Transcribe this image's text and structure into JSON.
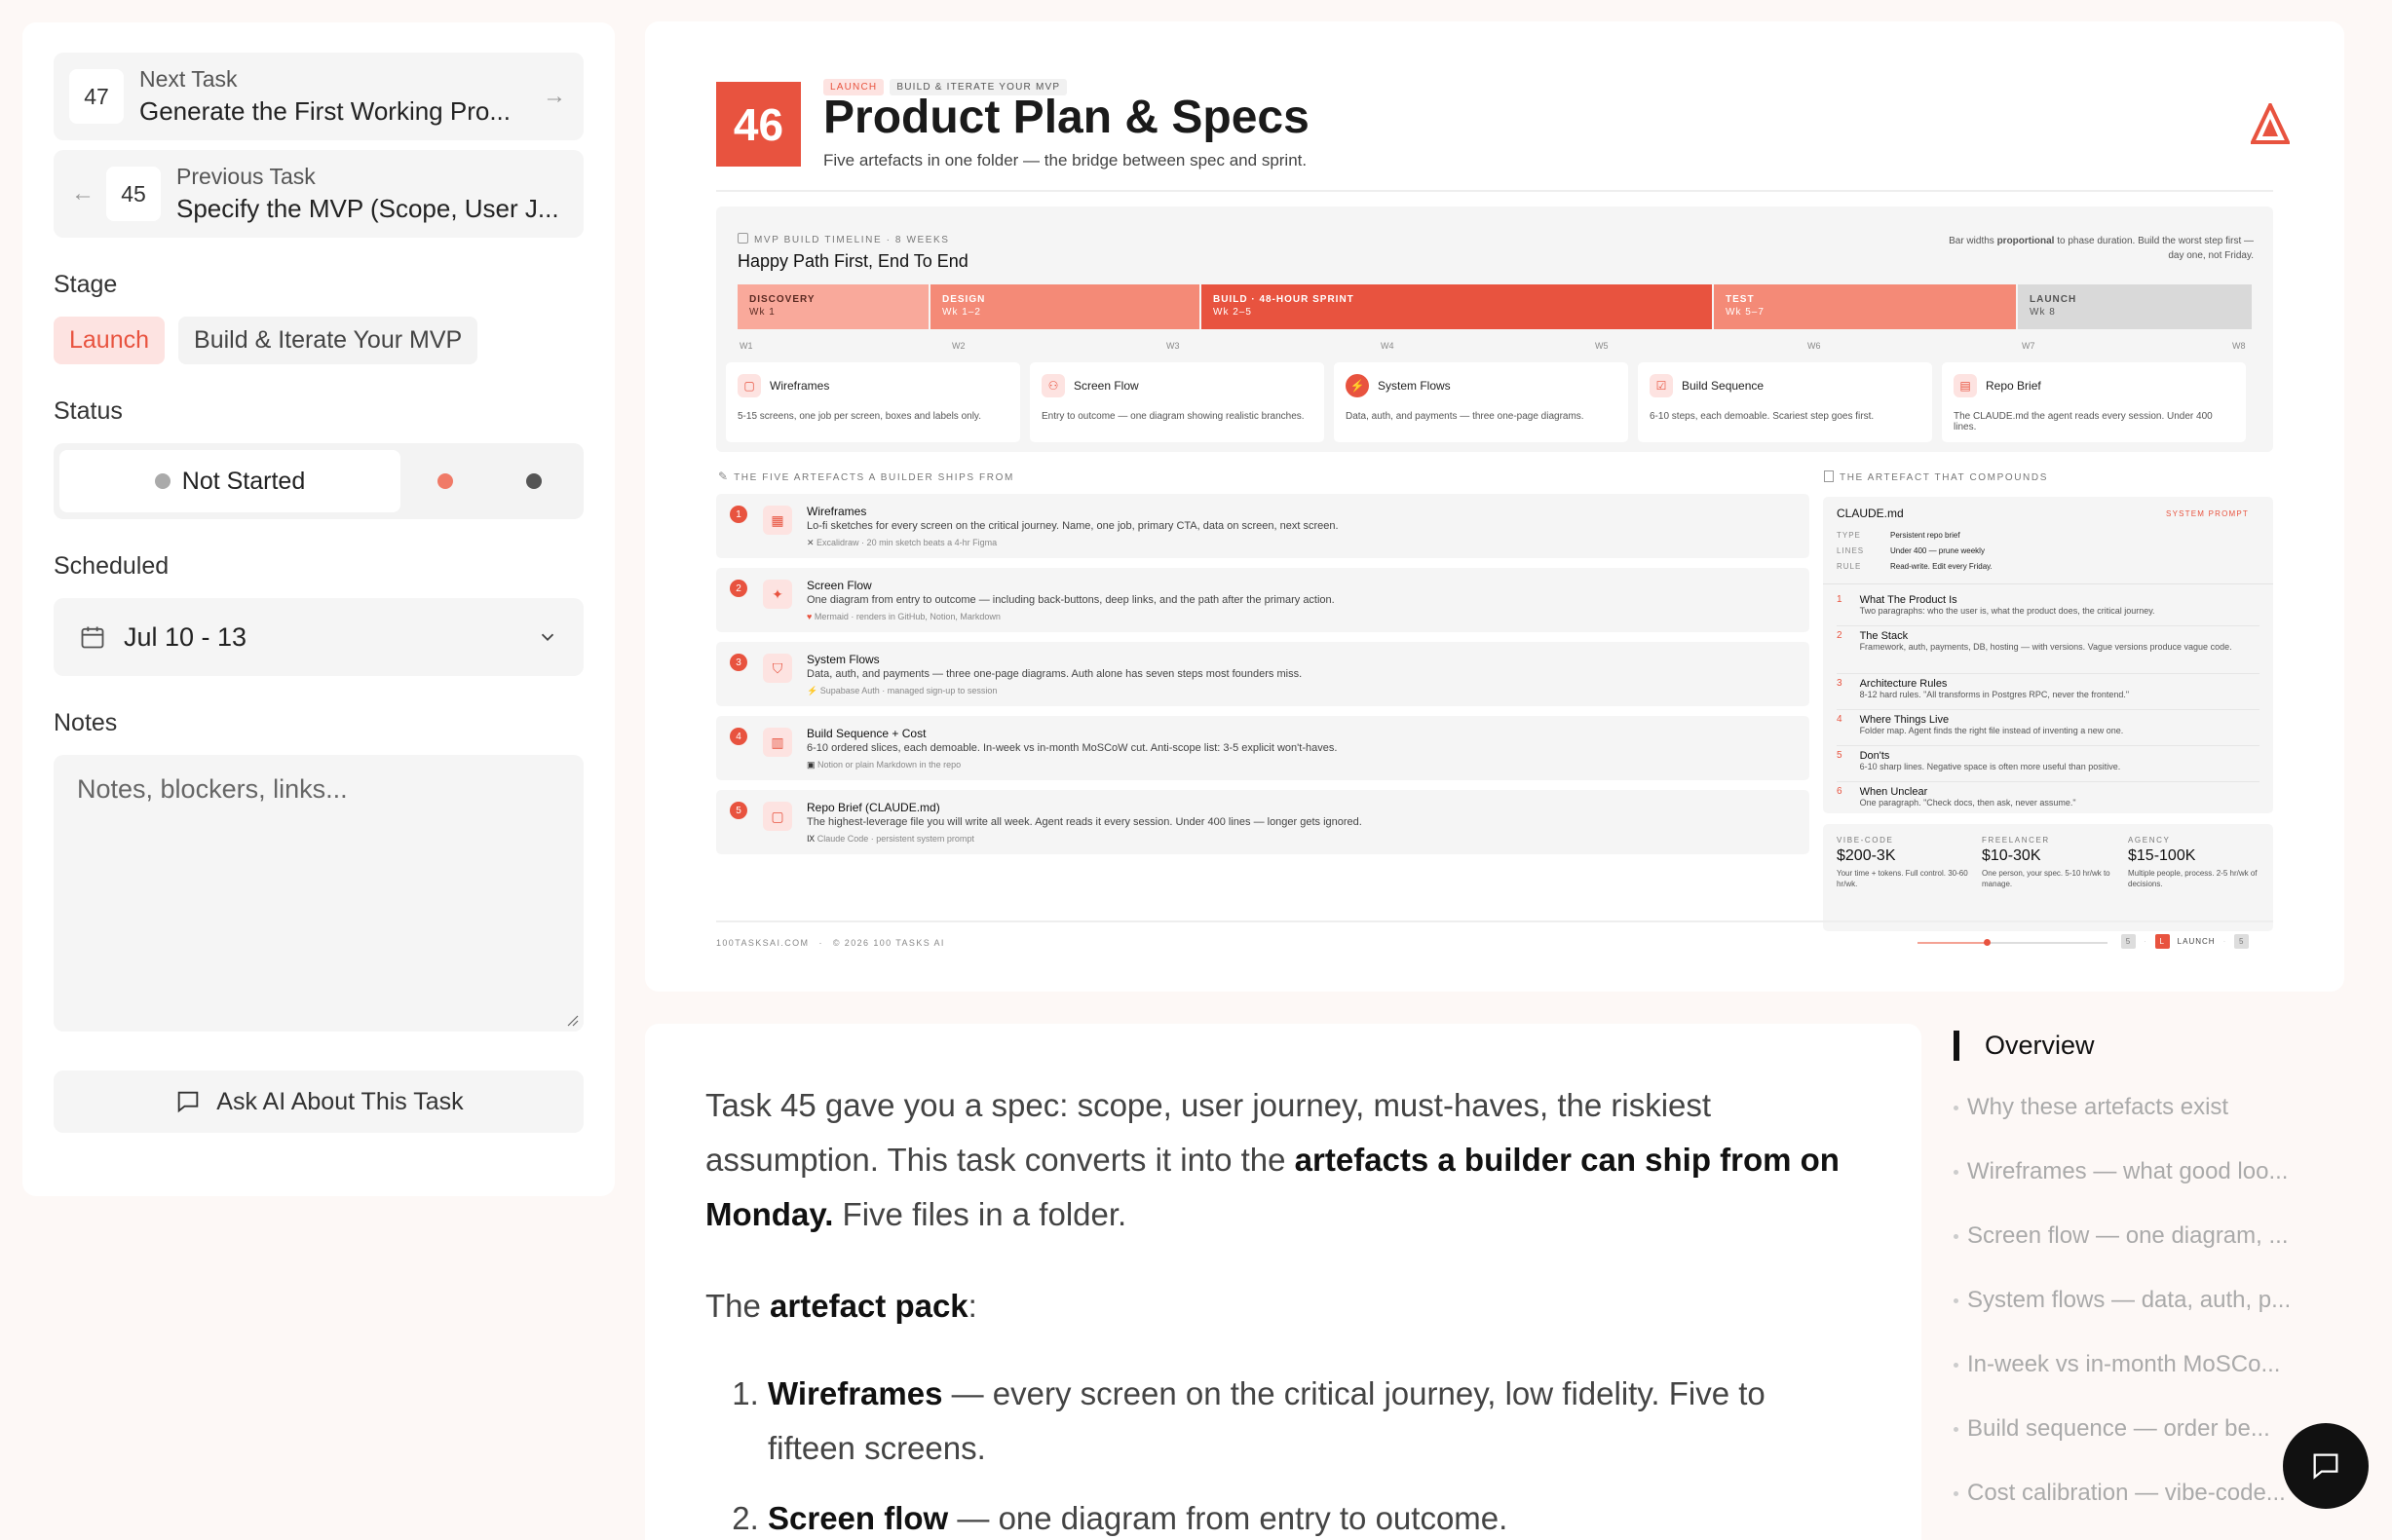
{
  "sidebar": {
    "next": {
      "num": "47",
      "kicker": "Next Task",
      "title": "Generate the First Working Pro..."
    },
    "prev": {
      "num": "45",
      "kicker": "Previous Task",
      "title": "Specify the MVP (Scope, User J..."
    },
    "stage_label": "Stage",
    "stage_chips": [
      "Launch",
      "Build & Iterate Your MVP"
    ],
    "status_label": "Status",
    "status_value": "Not Started",
    "scheduled_label": "Scheduled",
    "scheduled_value": "Jul 10 - 13",
    "notes_label": "Notes",
    "notes_placeholder": "Notes, blockers, links...",
    "ask_label": "Ask AI About This Task"
  },
  "slide": {
    "number": "46",
    "tags": [
      "LAUNCH",
      "BUILD & ITERATE YOUR MVP"
    ],
    "title": "Product Plan & Specs",
    "subtitle": "Five artefacts in one folder — the bridge between spec and sprint.",
    "timeline": {
      "kicker": "MVP BUILD TIMELINE · 8 WEEKS",
      "title": "Happy Path First, End To End",
      "note_a": "Bar widths ",
      "note_b": "proportional",
      "note_c": " to phase duration. Build the worst step first —",
      "note_d": "day one, not Friday.",
      "phases": [
        {
          "name": "DISCOVERY",
          "weeks": "Wk 1"
        },
        {
          "name": "DESIGN",
          "weeks": "Wk 1–2"
        },
        {
          "name": "BUILD · 48-HOUR SPRINT",
          "weeks": "Wk 2–5"
        },
        {
          "name": "TEST",
          "weeks": "Wk 5–7"
        },
        {
          "name": "LAUNCH",
          "weeks": "Wk 8"
        }
      ],
      "week_ticks": [
        "W1",
        "W2",
        "W3",
        "W4",
        "W5",
        "W6",
        "W7",
        "W8"
      ],
      "mini_cards": [
        {
          "title": "Wireframes",
          "desc": "5-15 screens, one job per screen, boxes and labels only."
        },
        {
          "title": "Screen Flow",
          "desc": "Entry to outcome — one diagram showing realistic branches."
        },
        {
          "title": "System Flows",
          "desc": "Data, auth, and payments — three one-page diagrams."
        },
        {
          "title": "Build Sequence",
          "desc": "6-10 steps, each demoable. Scariest step goes first."
        },
        {
          "title": "Repo Brief",
          "desc": "The CLAUDE.md the agent reads every session. Under 400 lines."
        }
      ]
    },
    "artefacts_kicker": "THE FIVE ARTEFACTS A BUILDER SHIPS FROM",
    "artefacts": [
      {
        "n": "1",
        "title": "Wireframes",
        "desc": "Lo-fi sketches for every screen on the critical journey. Name, one job, primary CTA, data on screen, next screen.",
        "meta": "Excalidraw · 20 min sketch beats a 4-hr Figma"
      },
      {
        "n": "2",
        "title": "Screen Flow",
        "desc": "One diagram from entry to outcome — including back-buttons, deep links, and the path after the primary action.",
        "meta": "Mermaid · renders in GitHub, Notion, Markdown"
      },
      {
        "n": "3",
        "title": "System Flows",
        "desc": "Data, auth, and payments — three one-page diagrams. Auth alone has seven steps most founders miss.",
        "meta": "Supabase Auth · managed sign-up to session"
      },
      {
        "n": "4",
        "title": "Build Sequence + Cost",
        "desc": "6-10 ordered slices, each demoable. In-week vs in-month MoSCoW cut. Anti-scope list: 3-5 explicit won't-haves.",
        "meta": "Notion or plain Markdown in the repo"
      },
      {
        "n": "5",
        "title": "Repo Brief (CLAUDE.md)",
        "desc": "The highest-leverage file you will write all week. Agent reads it every session. Under 400 lines — longer gets ignored.",
        "meta": "Claude Code · persistent system prompt"
      }
    ],
    "compounds_kicker": "THE ARTEFACT THAT COMPOUNDS",
    "claude": {
      "file": "CLAUDE.md",
      "badge": "SYSTEM PROMPT",
      "rows": [
        {
          "k": "TYPE",
          "v": "Persistent repo brief"
        },
        {
          "k": "LINES",
          "v": "Under 400 — prune weekly"
        },
        {
          "k": "RULE",
          "v": "Read-write. Edit every Friday."
        }
      ],
      "sections": [
        {
          "n": "1",
          "t": "What The Product Is",
          "d": "Two paragraphs: who the user is, what the product does, the critical journey."
        },
        {
          "n": "2",
          "t": "The Stack",
          "d": "Framework, auth, payments, DB, hosting — with versions. Vague versions produce vague code."
        },
        {
          "n": "3",
          "t": "Architecture Rules",
          "d": "8-12 hard rules. \"All transforms in Postgres RPC, never the frontend.\""
        },
        {
          "n": "4",
          "t": "Where Things Live",
          "d": "Folder map. Agent finds the right file instead of inventing a new one."
        },
        {
          "n": "5",
          "t": "Don'ts",
          "d": "6-10 sharp lines. Negative space is often more useful than positive."
        },
        {
          "n": "6",
          "t": "When Unclear",
          "d": "One paragraph. \"Check docs, then ask, never assume.\""
        }
      ]
    },
    "prices": [
      {
        "k": "VIBE-CODE",
        "v": "$200-3K",
        "d": "Your time + tokens. Full control. 30-60 hr/wk."
      },
      {
        "k": "FREELANCER",
        "v": "$10-30K",
        "d": "One person, your spec. 5-10 hr/wk to manage."
      },
      {
        "k": "AGENCY",
        "v": "$15-100K",
        "d": "Multiple people, process. 2-5 hr/wk of decisions."
      }
    ],
    "footer_site": "100TASKSAI.COM",
    "footer_copy": "© 2026 100 TASKS AI",
    "footer_step_prev": "5",
    "footer_step_cur": "L",
    "footer_step_label": "LAUNCH",
    "footer_step_next": "5"
  },
  "article": {
    "p1_a": "Task 45 gave you a spec: scope, user journey, must-haves, the riskiest assumption. This task converts it into the ",
    "p1_b": "artefacts a builder can ship from on Monday.",
    "p1_c": " Five files in a folder.",
    "p2_a": "The ",
    "p2_b": "artefact pack",
    "p2_c": ":",
    "li1_b": "Wireframes",
    "li1_c": " — every screen on the critical journey, low fidelity. Five to fifteen screens.",
    "li2_b": "Screen flow",
    "li2_c": " — one diagram from entry to outcome."
  },
  "toc": {
    "active": "Overview",
    "items": [
      "Why these artefacts exist",
      "Wireframes — what good loo...",
      "Screen flow — one diagram, ...",
      "System flows — data, auth, p...",
      "In-week vs in-month MoSCo...",
      "Build sequence — order be...",
      "Cost calibration — vibe-code..."
    ]
  },
  "colors": {
    "accent": "#e8533f",
    "accent_light": "#fde3e1",
    "panel": "#f5f5f5"
  }
}
